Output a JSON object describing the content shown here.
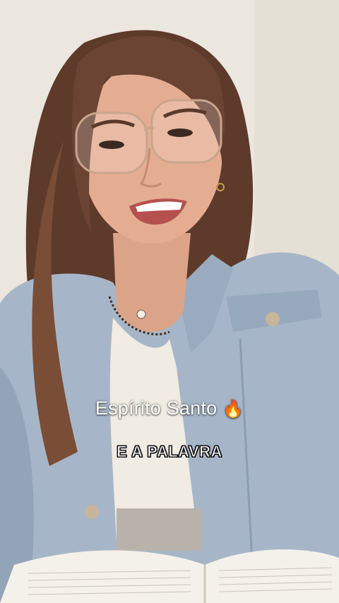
{
  "captions": {
    "main": "Espírito Santo",
    "main_emoji": "🔥",
    "sub": "E A PALAVRA"
  },
  "colors": {
    "wall": "#ece7df",
    "jacket": "#a7b7c9",
    "hair": "#6b4433",
    "skin": "#e5ae93",
    "top": "#f1ece4",
    "book": "#f4f1ea"
  },
  "scene": {
    "subject": "woman",
    "prop": "open-bible-icon"
  }
}
